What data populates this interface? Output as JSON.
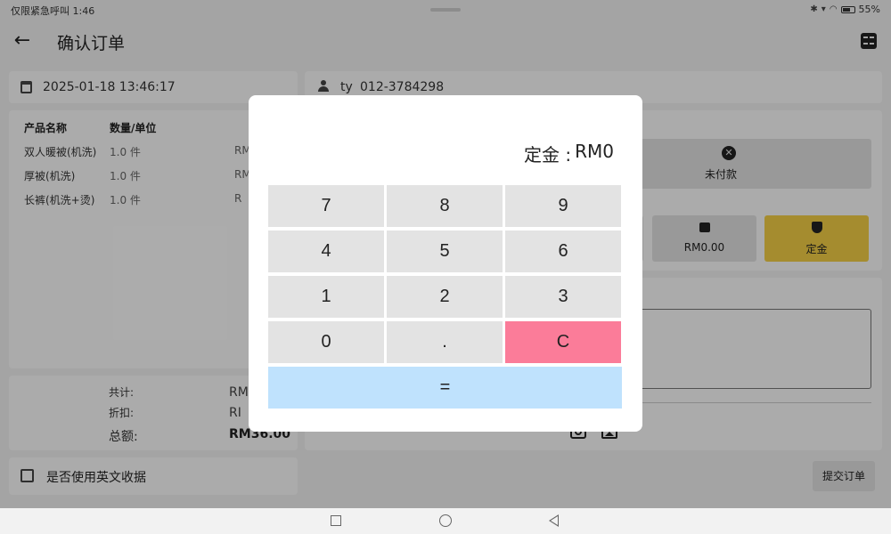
{
  "status_bar": {
    "left_text": "仅限紧急呼叫 1:46",
    "battery": "55%"
  },
  "app_bar": {
    "back_icon": "←",
    "title": "确认订单"
  },
  "order": {
    "datetime": "2025-01-18 13:46:17",
    "customer_name": "ty",
    "customer_phone": "012-3784298"
  },
  "items": {
    "headers": {
      "name": "产品名称",
      "qty": "数量/单位"
    },
    "rows": [
      {
        "name": "双人暖被(机洗)",
        "qty": "1.0 件",
        "price": "RM"
      },
      {
        "name": "厚被(机洗)",
        "qty": "1.0 件",
        "price": "RM"
      },
      {
        "name": "长裤(机洗+烫)",
        "qty": "1.0 件",
        "price": "R"
      }
    ]
  },
  "totals": {
    "subtotal_label": "共计:",
    "subtotal_value": "RM",
    "discount_label": "折扣:",
    "discount_value": "RI",
    "total_label": "总额:",
    "total_value": "RM36.00"
  },
  "english_receipt_label": "是否使用英文收据",
  "payment": {
    "unpaid_label": "未付款",
    "unpaid_icon": "✕",
    "wallet_label": "RM0.00",
    "deposit_label": "定金"
  },
  "submit_label": "提交订单",
  "dialog": {
    "display_label": "定金 :",
    "display_value": "RM0",
    "keys": {
      "k7": "7",
      "k8": "8",
      "k9": "9",
      "k4": "4",
      "k5": "5",
      "k6": "6",
      "k1": "1",
      "k2": "2",
      "k3": "3",
      "k0": "0",
      "dot": ".",
      "clear": "C",
      "equals": "="
    }
  }
}
